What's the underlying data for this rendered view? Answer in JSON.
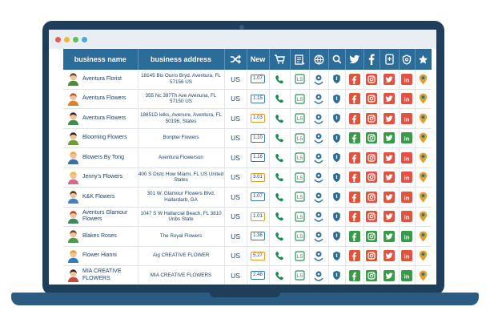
{
  "window": {
    "controls": [
      "#e35b57",
      "#f0b640",
      "#5dc059",
      "#4ea8da"
    ]
  },
  "table": {
    "columns": [
      {
        "label": "business name",
        "icon": null
      },
      {
        "label": "business address",
        "icon": null
      },
      {
        "label": "",
        "icon": "shuffle-icon"
      },
      {
        "label": "New",
        "icon": null
      },
      {
        "label": "",
        "icon": "cart-icon"
      },
      {
        "label": "",
        "icon": "list-icon"
      },
      {
        "label": "",
        "icon": "globe-icon"
      },
      {
        "label": "",
        "icon": "search-icon"
      },
      {
        "label": "",
        "icon": "twitter-icon"
      },
      {
        "label": "",
        "icon": "facebook-icon"
      },
      {
        "label": "",
        "icon": "tablet-icon"
      },
      {
        "label": "",
        "icon": "shield-icon"
      },
      {
        "label": "",
        "icon": "star-icon"
      }
    ],
    "rows": [
      {
        "name": "Aventura Florist",
        "address": "18145 Bis Ourro Bryd. Aventura, FL 57156 US",
        "country": "US",
        "new": "1.07",
        "avatar_hair": "#6b4a2e",
        "avatar_shirt": "#4d8a3c"
      },
      {
        "name": "Aventura Flowers",
        "address": "355 Nc 397Th Ave Avenuna, FL 57150 US",
        "country": "US",
        "new": "1.15",
        "avatar_hair": "#c2542a",
        "avatar_shirt": "#d9822b"
      },
      {
        "name": "Aventura Flowers",
        "address": "18851D lelks, Avenure, Aventura, FL 50196, States",
        "country": "US",
        "new": "1.03",
        "avatar_hair": "#3a2a20",
        "avatar_shirt": "#3f8f4b"
      },
      {
        "name": "Blooming Flowers",
        "address": "Bonptei Flowers",
        "country": "US",
        "new": "1.10",
        "avatar_hair": "#2f2520",
        "avatar_shirt": "#6e9c3b"
      },
      {
        "name": "Blowers By Tong",
        "address": "Aventura Flowerson",
        "country": "US",
        "new": "1.16",
        "avatar_hair": "#e8b23a",
        "avatar_shirt": "#3a6fa8"
      },
      {
        "name": "Jenny's Flowers",
        "address": "400 S Distc How Miami, FL US United States",
        "country": "US",
        "new": "3.01",
        "avatar_hair": "#e9c24a",
        "avatar_shirt": "#d66a8d"
      },
      {
        "name": "K&K Flowers",
        "address": "301 W. Glamour Flowers Blvd. Hallardarb, GA",
        "country": "US",
        "new": "1.07",
        "avatar_hair": "#5a3a22",
        "avatar_shirt": "#4a7fb8"
      },
      {
        "name": "Aventurs Glamour Flowers",
        "address": "1047 S W Hallarcial Beach, FL 3810 Unbs State",
        "country": "US",
        "new": "1.01",
        "avatar_hair": "#b8412c",
        "avatar_shirt": "#3d8a5a"
      },
      {
        "name": "Blakes Roses",
        "address": "The Royal Flowers",
        "country": "US",
        "new": "1.36",
        "avatar_hair": "#6e4a2a",
        "avatar_shirt": "#4f9a4a"
      },
      {
        "name": "Flower Hianni",
        "address": "Aig CREATIVE FLOWER",
        "country": "US",
        "new": "5.27",
        "avatar_hair": "#d7a23b",
        "avatar_shirt": "#2f7bbf"
      },
      {
        "name": "MIA CREATIVE FLOWERS",
        "address": "MIA CREATIVE FLOWERS",
        "country": "US",
        "new": "2.48",
        "avatar_hair": "#3a2a20",
        "avatar_shirt": "#c94a3a"
      }
    ]
  },
  "colors": {
    "header_bg": "#2b6c98",
    "phone": "#1c8a55",
    "badge_border_blue": "#3b79b2",
    "badge_border_orange": "#e49b2b",
    "facebook": "#e2523f",
    "instagram": "#e2523f",
    "twitter": "#e2523f",
    "linkedin": "#e2523f",
    "facebook_alt": "#3a9a4a",
    "instagram_alt": "#3a9a4a",
    "twitter_alt": "#3a9a4a",
    "linkedin_alt": "#3a9a4a",
    "pin": "#e1a02e",
    "shield": "#2b6c98"
  }
}
